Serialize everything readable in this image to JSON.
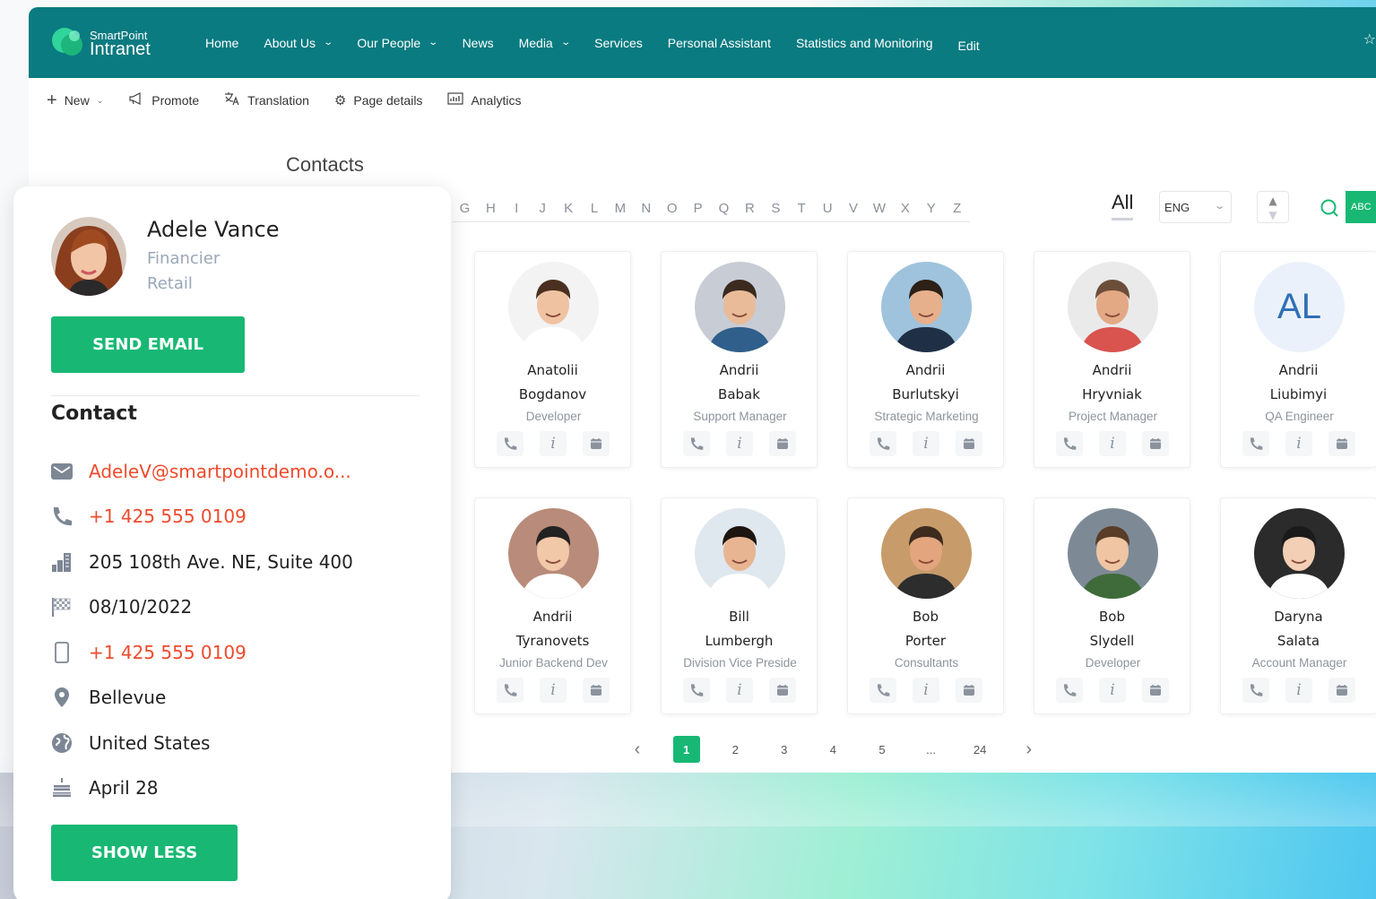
{
  "header": {
    "logo_small": "SmartPoint",
    "logo_big": "Intranet",
    "nav": [
      {
        "label": "Home",
        "has_dropdown": false
      },
      {
        "label": "About Us",
        "has_dropdown": true
      },
      {
        "label": "Our People",
        "has_dropdown": true
      },
      {
        "label": "News",
        "has_dropdown": false
      },
      {
        "label": "Media",
        "has_dropdown": true
      },
      {
        "label": "Services",
        "has_dropdown": false
      },
      {
        "label": "Personal Assistant",
        "has_dropdown": false
      },
      {
        "label": "Statistics and Monitoring",
        "has_dropdown": false
      },
      {
        "label": "Edit",
        "has_dropdown": false
      }
    ],
    "accent": "#0a7b80"
  },
  "commandbar": {
    "new": "New",
    "promote": "Promote",
    "translation": "Translation",
    "page_details": "Page details",
    "analytics": "Analytics"
  },
  "directory": {
    "title": "Contacts",
    "letters": [
      "G",
      "H",
      "I",
      "J",
      "K",
      "L",
      "M",
      "N",
      "O",
      "P",
      "Q",
      "R",
      "S",
      "T",
      "U",
      "V",
      "W",
      "X",
      "Y",
      "Z"
    ],
    "all_label": "All",
    "language": "ENG",
    "abc_label": "ABC",
    "accent": "#18b874",
    "people": [
      {
        "first": "Anatolii",
        "last": "Bogdanov",
        "role": "Developer",
        "photo": "p1"
      },
      {
        "first": "Andrii",
        "last": "Babak",
        "role": "Support Manager",
        "photo": "p2"
      },
      {
        "first": "Andrii",
        "last": "Burlutskyi",
        "role": "Strategic Marketing",
        "photo": "p3"
      },
      {
        "first": "Andrii",
        "last": "Hryvniak",
        "role": "Project Manager",
        "photo": "p4"
      },
      {
        "first": "Andrii",
        "last": "Liubimyi",
        "role": "QA Engineer",
        "initials": "AL"
      },
      {
        "first": "Andrii",
        "last": "Tyranovets",
        "role": "Junior Backend Dev",
        "photo": "p6"
      },
      {
        "first": "Bill",
        "last": "Lumbergh",
        "role": "Division Vice Preside",
        "photo": "p7"
      },
      {
        "first": "Bob",
        "last": "Porter",
        "role": "Consultants",
        "photo": "p8"
      },
      {
        "first": "Bob",
        "last": "Slydell",
        "role": "Developer",
        "photo": "p9"
      },
      {
        "first": "Daryna",
        "last": "Salata",
        "role": "Account Manager",
        "photo": "p10"
      }
    ],
    "pagination": {
      "pages": [
        "1",
        "2",
        "3",
        "4",
        "5",
        "...",
        "24"
      ],
      "current": "1"
    }
  },
  "profile": {
    "name": "Adele Vance",
    "title": "Financier",
    "department": "Retail",
    "send_email": "SEND EMAIL",
    "contact_heading": "Contact",
    "email": "AdeleV@smartpointdemo.o...",
    "phone": "+1 425 555 0109",
    "address": "205 108th Ave. NE, Suite 400",
    "date": "08/10/2022",
    "mobile": "+1 425 555 0109",
    "city": "Bellevue",
    "country": "United States",
    "birthday": "April 28",
    "show_less": "SHOW LESS",
    "link_color": "#ef4a2c"
  }
}
